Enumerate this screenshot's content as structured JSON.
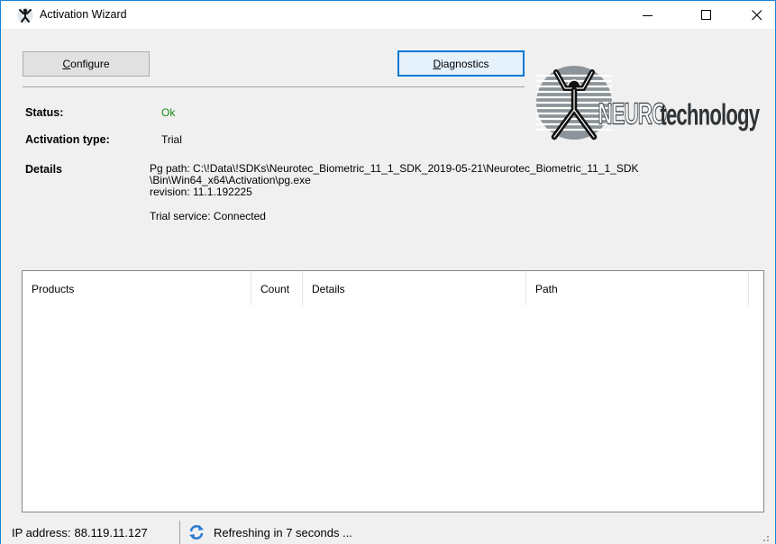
{
  "window": {
    "title": "Activation Wizard",
    "app_icon": "neurotechnology-figure-icon",
    "controls": {
      "minimize_icon": "minimize-icon",
      "maximize_icon": "maximize-icon",
      "close_icon": "close-icon"
    }
  },
  "toolbar": {
    "configure": {
      "accel": "C",
      "rest": "onfigure"
    },
    "diagnostics": {
      "accel": "D",
      "rest": "iagnostics"
    }
  },
  "info": {
    "status_label": "Status:",
    "status_value": "Ok",
    "activation_type_label": "Activation type:",
    "activation_type_value": "Trial",
    "details_label": "Details",
    "details_lines": [
      "Pg path: C:\\!Data\\!SDKs\\Neurotec_Biometric_11_1_SDK_2019-05-21\\Neurotec_Biometric_11_1_SDK",
      "\\Bin\\Win64_x64\\Activation\\pg.exe",
      "revision: 11.1.192225"
    ],
    "trial_service": "Trial service: Connected"
  },
  "logo": {
    "text_caps": "NEURO",
    "text_rest": "technology"
  },
  "products_table": {
    "columns": [
      "Products",
      "Count",
      "Details",
      "Path"
    ],
    "rows": []
  },
  "statusbar": {
    "ip_label": "IP address:",
    "ip_value": "88.119.11.127",
    "refresh_icon": "refresh-icon",
    "refresh_text": "Refreshing in 7 seconds ..."
  },
  "colors": {
    "status_ok": "#168a16",
    "window_border": "#1883d7",
    "focus_border": "#0078d7"
  }
}
